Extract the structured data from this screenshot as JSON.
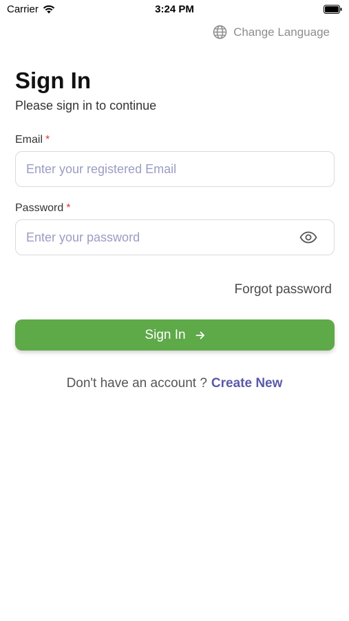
{
  "status_bar": {
    "carrier": "Carrier",
    "time": "3:24 PM"
  },
  "change_language": {
    "label": "Change Language",
    "icon": "globe-icon"
  },
  "heading": {
    "title": "Sign In",
    "subtitle": "Please sign in to continue"
  },
  "email": {
    "label": "Email",
    "required_mark": "*",
    "placeholder": "Enter your registered Email",
    "value": ""
  },
  "password": {
    "label": "Password",
    "required_mark": "*",
    "placeholder": "Enter your password",
    "value": "",
    "toggle_icon": "eye-icon"
  },
  "forgot_password": "Forgot password",
  "sign_in_button": {
    "label": "Sign In",
    "icon": "arrow-right-icon"
  },
  "signup_prompt": {
    "text": "Don't have an account ?",
    "link": "Create New"
  },
  "colors": {
    "primary_green": "#5ea948",
    "link_purple": "#5a5aa8",
    "required_red": "#e53935",
    "placeholder": "#9a9cc4"
  }
}
